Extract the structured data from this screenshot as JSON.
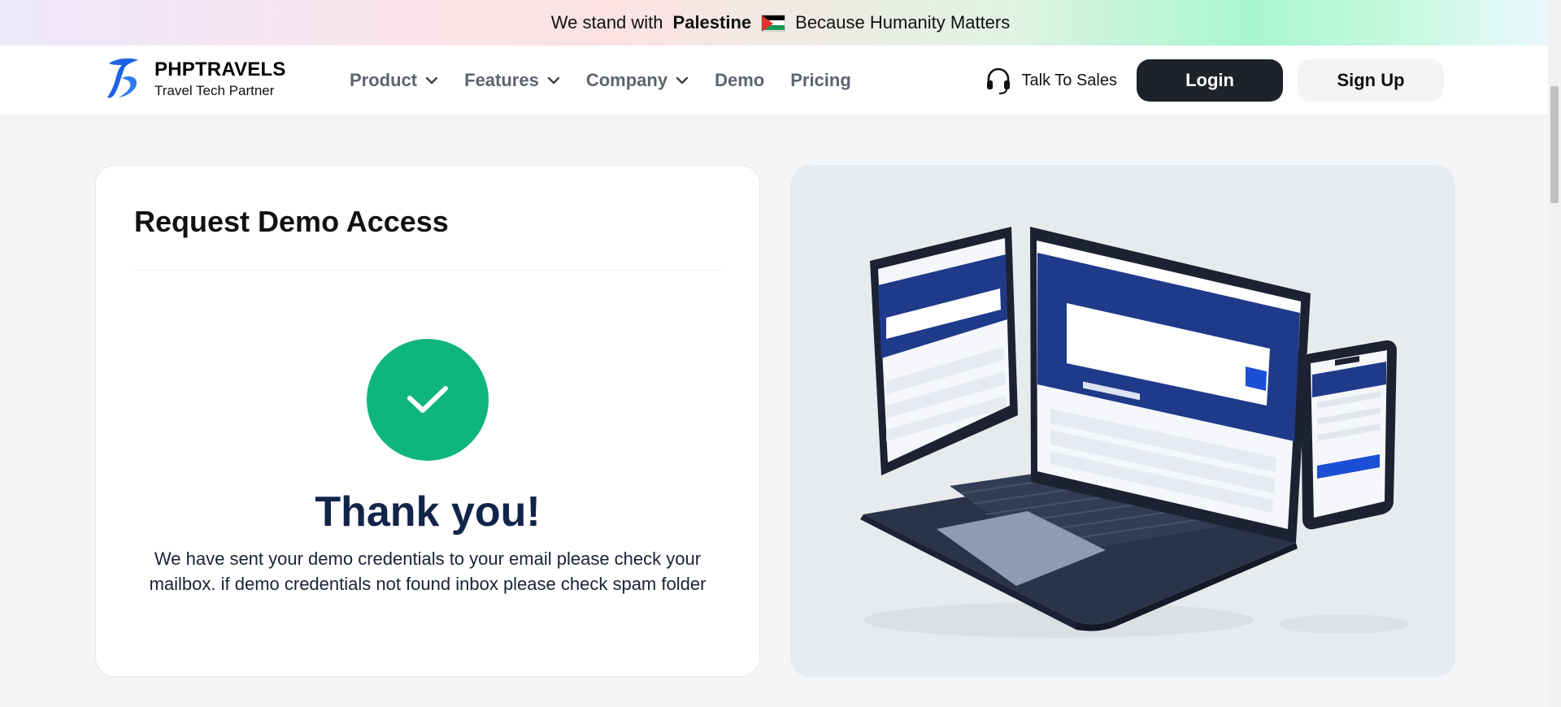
{
  "banner": {
    "prefix": "We stand with",
    "highlight": "Palestine",
    "suffix": "Because Humanity Matters"
  },
  "header": {
    "brand_name": "PHPTRAVELS",
    "brand_tagline": "Travel Tech Partner",
    "menu": [
      {
        "label": "Product",
        "has_dropdown": true
      },
      {
        "label": "Features",
        "has_dropdown": true
      },
      {
        "label": "Company",
        "has_dropdown": true
      },
      {
        "label": "Demo",
        "has_dropdown": false
      },
      {
        "label": "Pricing",
        "has_dropdown": false
      }
    ],
    "sales_label": "Talk To Sales",
    "login_label": "Login",
    "signup_label": "Sign Up"
  },
  "form_card": {
    "title": "Request Demo Access",
    "thanks": "Thank you!",
    "message": "We have sent your demo credentials to your email please check your mailbox. if demo credentials not found inbox please check spam folder"
  },
  "colors": {
    "primary_dark": "#1e2229",
    "success": "#0fb57e",
    "heading_navy": "#13244a",
    "brand_blue": "#1c63e6"
  },
  "icons": {
    "check": "check-icon",
    "headset": "headset-icon",
    "chevron": "chevron-down-icon"
  }
}
